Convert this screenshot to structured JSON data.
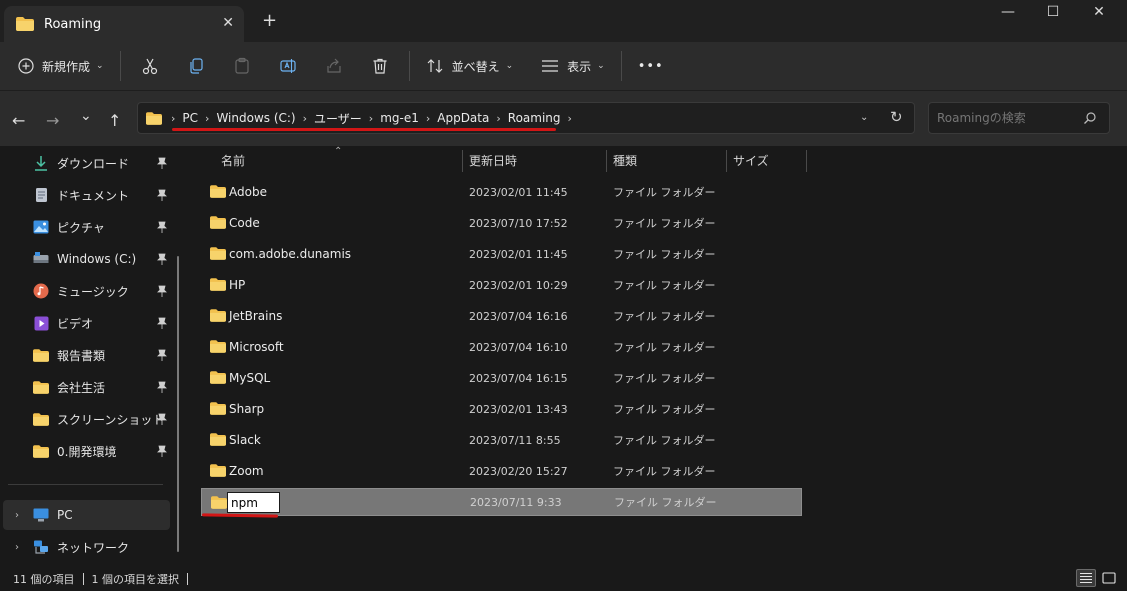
{
  "window": {
    "tab_title": "Roaming",
    "tab_close": "✕",
    "new_tab": "+",
    "minimize": "—",
    "maximize": "☐",
    "close": "✕"
  },
  "toolbar": {
    "new_label": "新規作成",
    "sort_label": "並べ替え",
    "view_label": "表示",
    "more": "•••",
    "icons": [
      "new-icon",
      "cut-icon",
      "copy-icon",
      "paste-icon",
      "rename-icon",
      "share-icon",
      "delete-icon",
      "sort-icon",
      "view-icon",
      "more-icon"
    ]
  },
  "nav": {
    "back": "←",
    "forward": "→",
    "recent": "⌄",
    "up": "↑"
  },
  "address": {
    "crumbs": [
      "PC",
      "Windows (C:)",
      "ユーザー",
      "mg-e1",
      "AppData",
      "Roaming"
    ],
    "separator": "›",
    "dropdown": "⌄",
    "refresh": "↻"
  },
  "search": {
    "placeholder": "Roamingの検索"
  },
  "sidebar": {
    "quick_access": [
      {
        "label": "ダウンロード",
        "icon": "download-icon"
      },
      {
        "label": "ドキュメント",
        "icon": "document-icon"
      },
      {
        "label": "ピクチャ",
        "icon": "picture-icon"
      },
      {
        "label": "Windows (C:)",
        "icon": "drive-icon"
      },
      {
        "label": "ミュージック",
        "icon": "music-icon"
      },
      {
        "label": "ビデオ",
        "icon": "video-icon"
      },
      {
        "label": "報告書類",
        "icon": "folder-icon"
      },
      {
        "label": "会社生活",
        "icon": "folder-icon"
      },
      {
        "label": "スクリーンショット",
        "icon": "folder-icon"
      },
      {
        "label": "0.開発環境",
        "icon": "folder-icon"
      }
    ],
    "pc_label": "PC",
    "network_label": "ネットワーク",
    "expand": "›"
  },
  "columns": {
    "name": "名前",
    "date": "更新日時",
    "type": "種類",
    "size": "サイズ",
    "sort": "⌃"
  },
  "files": [
    {
      "name": "Adobe",
      "date": "2023/02/01 11:45",
      "type": "ファイル フォルダー"
    },
    {
      "name": "Code",
      "date": "2023/07/10 17:52",
      "type": "ファイル フォルダー"
    },
    {
      "name": "com.adobe.dunamis",
      "date": "2023/02/01 11:45",
      "type": "ファイル フォルダー"
    },
    {
      "name": "HP",
      "date": "2023/02/01 10:29",
      "type": "ファイル フォルダー"
    },
    {
      "name": "JetBrains",
      "date": "2023/07/04 16:16",
      "type": "ファイル フォルダー"
    },
    {
      "name": "Microsoft",
      "date": "2023/07/04 16:10",
      "type": "ファイル フォルダー"
    },
    {
      "name": "MySQL",
      "date": "2023/07/04 16:15",
      "type": "ファイル フォルダー"
    },
    {
      "name": "Sharp",
      "date": "2023/02/01 13:43",
      "type": "ファイル フォルダー"
    },
    {
      "name": "Slack",
      "date": "2023/07/11 8:55",
      "type": "ファイル フォルダー"
    },
    {
      "name": "Zoom",
      "date": "2023/02/20 15:27",
      "type": "ファイル フォルダー"
    }
  ],
  "renaming": {
    "value": "npm",
    "date": "2023/07/11 9:33",
    "type": "ファイル フォルダー"
  },
  "status": {
    "item_count": "11 個の項目",
    "selected": "1 個の項目を選択"
  },
  "colors": {
    "accent_red": "#d21616",
    "folder_yellow": "#f2c14e",
    "selection": "#777777"
  }
}
